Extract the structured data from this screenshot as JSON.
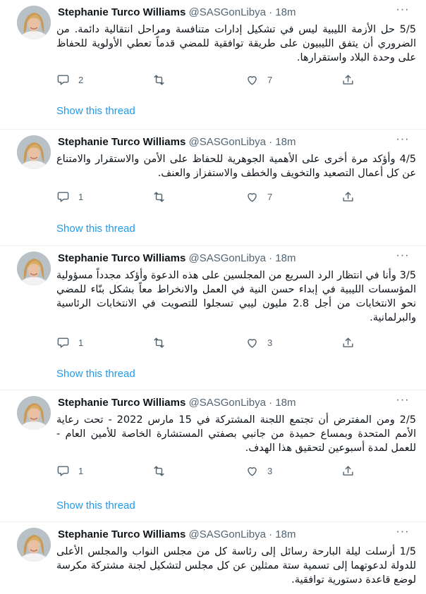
{
  "colors": {
    "link": "#1d9bf0",
    "secondary_text": "#536471",
    "primary_text": "#0f1419",
    "divider": "#eff3f4"
  },
  "icons": {
    "reply": "speech-bubble-icon",
    "retweet": "retweet-arrows-icon",
    "like": "heart-outline-icon",
    "share": "share-upload-icon",
    "more": "more-dots-icon"
  },
  "tweets": [
    {
      "name": "Stephanie Turco Williams",
      "handle": "@SASGonLibya",
      "sep": "·",
      "time": "18m",
      "more": "···",
      "text": "5/5 حل الأزمة الليبية ليس في تشكيل إدارات متنافسة ومراحل انتقالية دائمة. من الضروري أن يتفق الليبيون على طريقة توافقية للمضي قدماً تعطي الأولوية للحفاظ على وحدة البلاد واستقرارها.",
      "replies": "2",
      "retweets": "",
      "likes": "7",
      "thread_label": "Show this thread"
    },
    {
      "name": "Stephanie Turco Williams",
      "handle": "@SASGonLibya",
      "sep": "·",
      "time": "18m",
      "more": "···",
      "text": "4/5 وأؤكد مرة أخرى على الأهمية الجوهرية للحفاظ على الأمن والاستقرار والامتناع عن كل أعمال التصعيد والتخويف والخطف والاستفزاز والعنف.",
      "replies": "1",
      "retweets": "",
      "likes": "7",
      "thread_label": "Show this thread"
    },
    {
      "name": "Stephanie Turco Williams",
      "handle": "@SASGonLibya",
      "sep": "·",
      "time": "18m",
      "more": "···",
      "text": "3/5 وأنا في انتظار الرد السريع من المجلسين على هذه الدعوة وأؤكد مجدداً مسؤولية المؤسسات الليبية في إبداء حسن النية في العمل والانخراط معاً بشكل بنّاء للمضي نحو الانتخابات من أجل 2.8 مليون ليبي تسجلوا للتصويت في الانتخابات الرئاسية والبرلمانية.",
      "replies": "1",
      "retweets": "",
      "likes": "3",
      "thread_label": "Show this thread"
    },
    {
      "name": "Stephanie Turco Williams",
      "handle": "@SASGonLibya",
      "sep": "·",
      "time": "18m",
      "more": "···",
      "text": "2/5 ومن المفترض أن تجتمع اللجنة المشتركة في 15 مارس 2022 - تحت رعاية الأمم المتحدة وبمساع حميدة من جانبي بصفتي المستشارة الخاصة للأمين العام - للعمل لمدة أسبوعين لتحقيق هذا الهدف.",
      "replies": "1",
      "retweets": "",
      "likes": "3",
      "thread_label": "Show this thread"
    },
    {
      "name": "Stephanie Turco Williams",
      "handle": "@SASGonLibya",
      "sep": "·",
      "time": "18m",
      "more": "···",
      "text": "1/5 أرسلت ليلة البارحة رسائل إلى رئاسة كل من مجلس النواب والمجلس الأعلى للدولة لدعوتهما إلى تسمية ستة ممثلين عن كل مجلس لتشكيل لجنة مشتركة مكرسة لوضع قاعدة دستورية توافقية.",
      "replies": "",
      "retweets": "",
      "likes": "",
      "thread_label": ""
    }
  ]
}
